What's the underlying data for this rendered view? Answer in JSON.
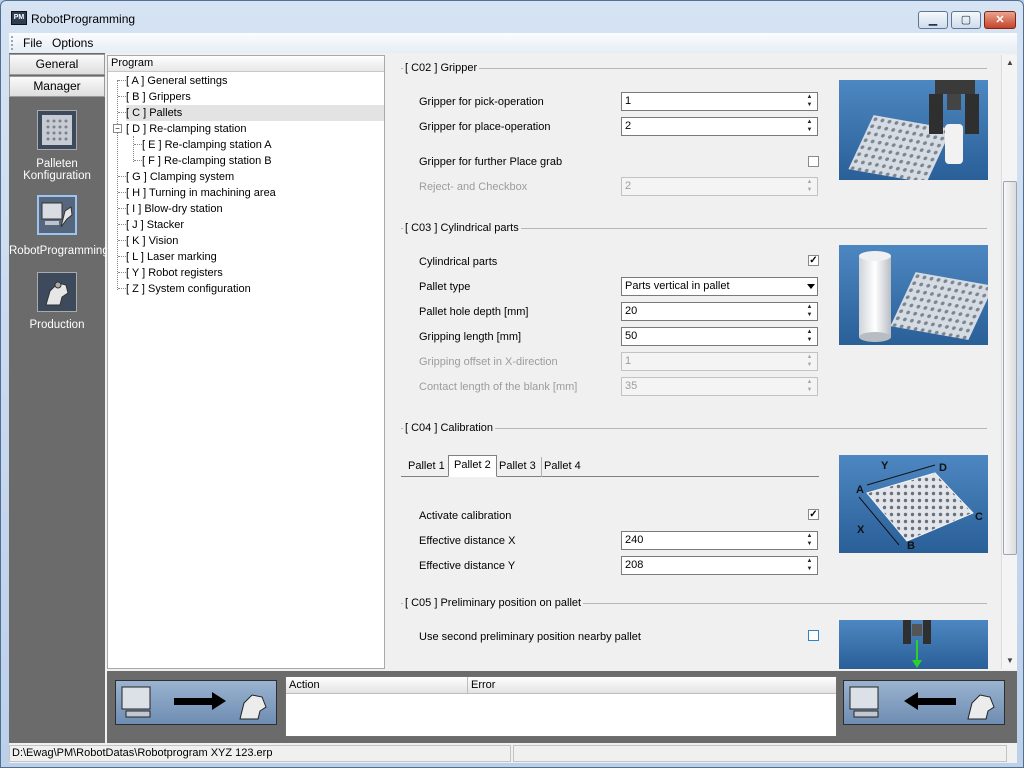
{
  "window": {
    "title": "RobotProgramming",
    "app_icon": "PM"
  },
  "menu": {
    "file": "File",
    "options": "Options"
  },
  "left_panel": {
    "tabs": [
      "General",
      "Manager"
    ],
    "items": [
      {
        "label": "Palleten Konfiguration",
        "icon": "pallet-config-icon"
      },
      {
        "label": "RobotProgramming",
        "icon": "robot-programming-icon",
        "selected": true
      },
      {
        "label": "Production",
        "icon": "production-robot-icon"
      }
    ]
  },
  "tree": {
    "header": "Program",
    "nodes": [
      "[ A ] General settings",
      "[ B ] Grippers",
      "[ C ] Pallets",
      "[ D ] Re-clamping station",
      "[ E ] Re-clamping station A",
      "[ F ] Re-clamping station B",
      "[ G ] Clamping system",
      "[ H ] Turning in machining area",
      "[ I ] Blow-dry station",
      "[ J ] Stacker",
      "[ K ] Vision",
      "[ L ] Laser marking",
      "[ Y ] Robot registers",
      "[ Z ] System configuration"
    ],
    "selected": "[ C ] Pallets"
  },
  "c02": {
    "title": "[ C02 ] Gripper",
    "pick_label": "Gripper for pick-operation",
    "pick_value": "1",
    "place_label": "Gripper for place-operation",
    "place_value": "2",
    "further_label": "Gripper for further Place grab",
    "further_checked": false,
    "reject_label": "Reject- and Checkbox",
    "reject_value": "2"
  },
  "c03": {
    "title": "[ C03 ] Cylindrical parts",
    "cyl_label": "Cylindrical parts",
    "cyl_checked": true,
    "type_label": "Pallet type",
    "type_value": "Parts vertical in pallet",
    "depth_label": "Pallet hole depth [mm]",
    "depth_value": "20",
    "grip_len_label": "Gripping length [mm]",
    "grip_len_value": "50",
    "offset_label": "Gripping offset in X-direction",
    "offset_value": "1",
    "contact_label": "Contact length of the blank [mm]",
    "contact_value": "35"
  },
  "c04": {
    "title": "[ C04 ] Calibration",
    "tabs": [
      "Pallet 1",
      "Pallet 2",
      "Pallet 3",
      "Pallet 4"
    ],
    "active_tab": "Pallet 2",
    "activate_label": "Activate calibration",
    "activate_checked": true,
    "dist_x_label": "Effective distance X",
    "dist_x_value": "240",
    "dist_y_label": "Effective distance Y",
    "dist_y_value": "208",
    "diagram_labels": {
      "a": "A",
      "b": "B",
      "c": "C",
      "d": "D",
      "x": "X",
      "y": "Y"
    }
  },
  "c05": {
    "title": "[ C05 ] Preliminary position on pallet",
    "second_label": "Use second preliminary position nearby pallet",
    "second_checked": false
  },
  "log": {
    "col_action": "Action",
    "col_error": "Error"
  },
  "status": {
    "path": "D:\\Ewag\\PM\\RobotDatas\\Robotprogram XYZ 123.erp",
    "right": ""
  },
  "colors": {
    "accent": "#3d7fc0",
    "panel": "#6b6b6b",
    "arrow_green": "#2bd12b"
  }
}
